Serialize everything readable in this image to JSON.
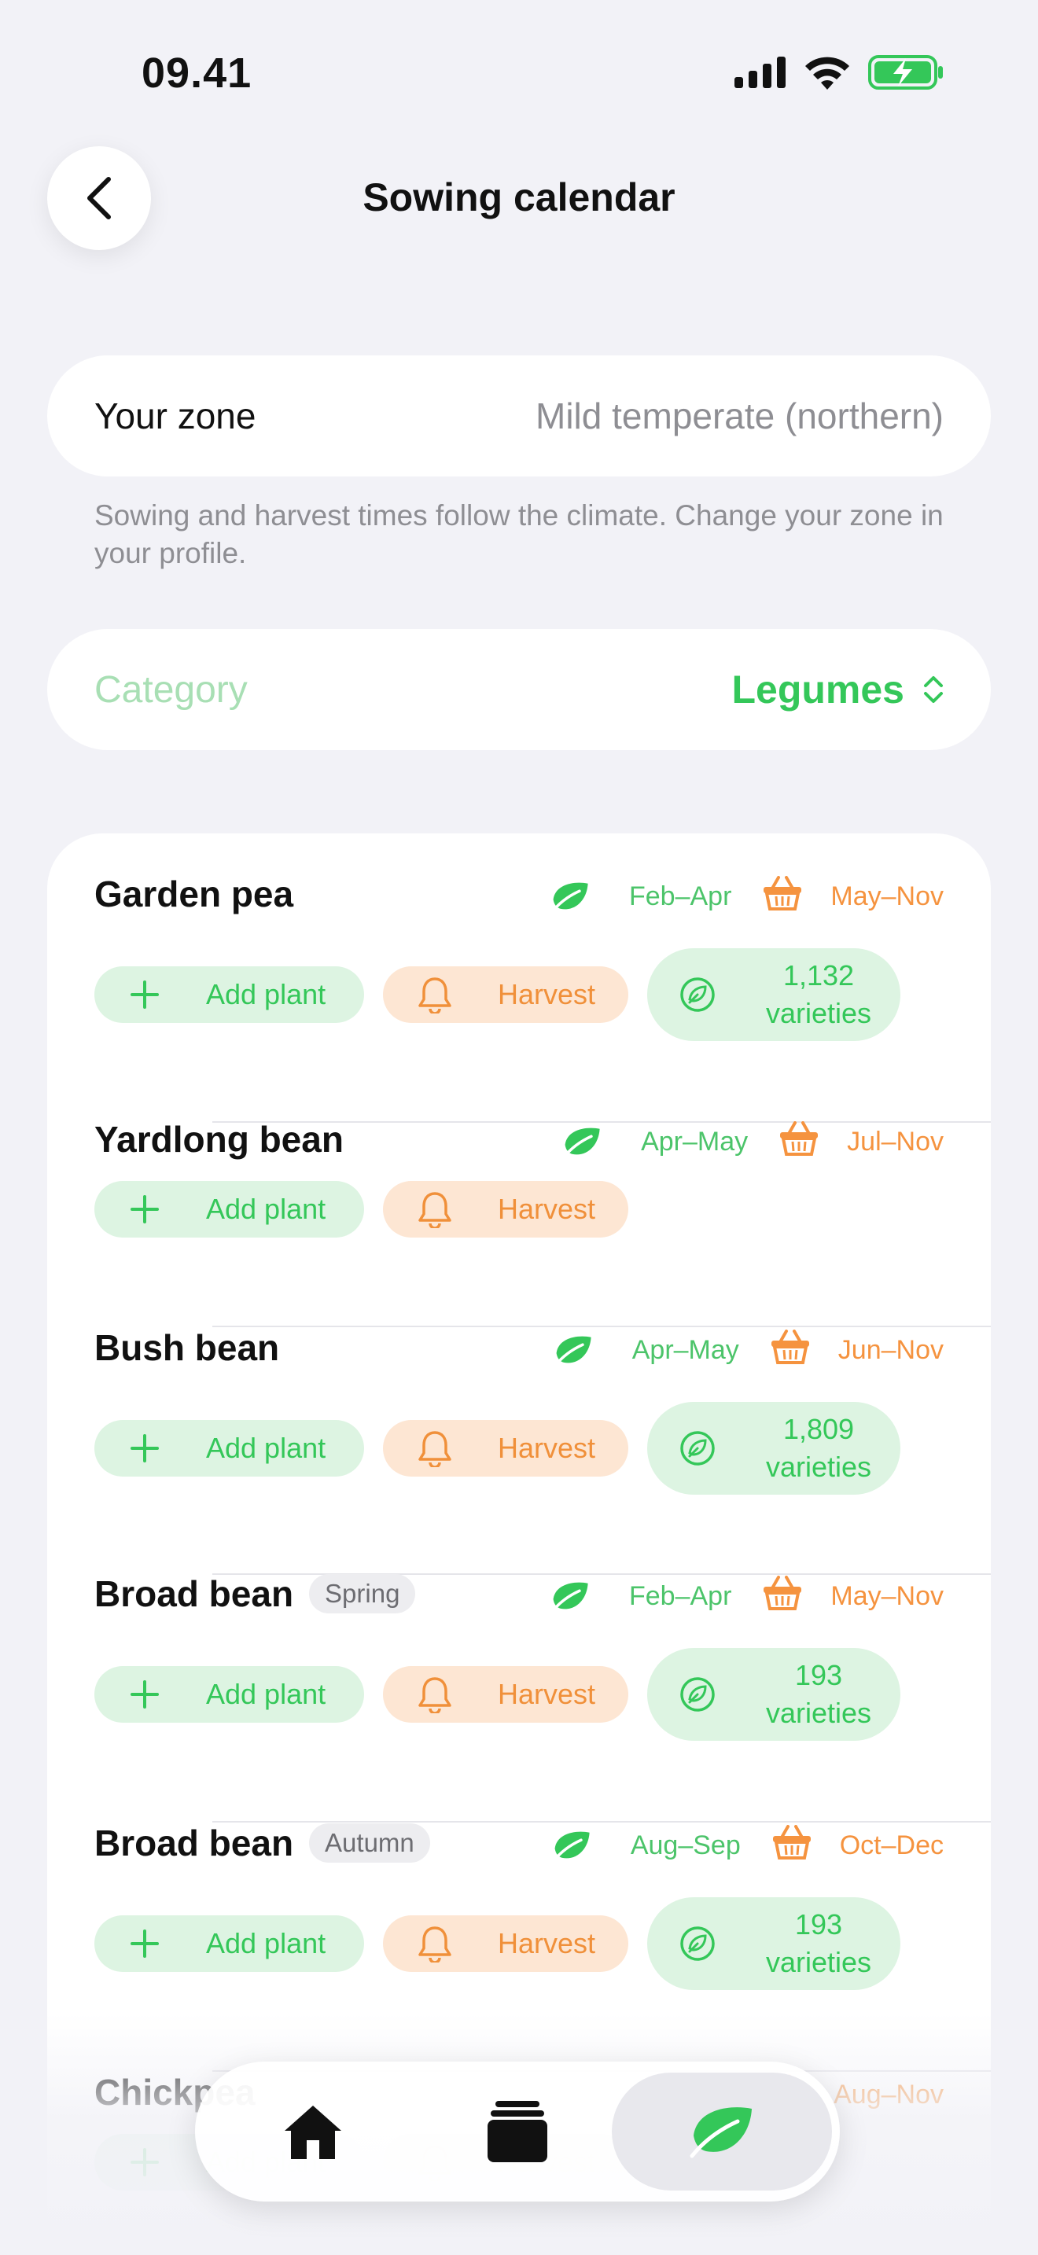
{
  "status_bar": {
    "time": "09.41"
  },
  "nav": {
    "title": "Sowing calendar"
  },
  "zone": {
    "label": "Your zone",
    "value": "Mild temperate (northern)",
    "note": "Sowing and harvest times follow the climate. Change your zone in your profile."
  },
  "category": {
    "label": "Category",
    "value": "Legumes"
  },
  "actions": {
    "add_label": "Add plant",
    "harvest_label": "Harvest",
    "varieties_suffix": "varieties"
  },
  "plants": [
    {
      "name": "Garden pea",
      "tag": "",
      "sow": "Feb–Apr",
      "harvest": "May–Nov",
      "varieties": "1,132"
    },
    {
      "name": "Yardlong bean",
      "tag": "",
      "sow": "Apr–May",
      "harvest": "Jul–Nov",
      "varieties": ""
    },
    {
      "name": "Bush bean",
      "tag": "",
      "sow": "Apr–May",
      "harvest": "Jun–Nov",
      "varieties": "1,809"
    },
    {
      "name": "Broad bean",
      "tag": "Spring",
      "sow": "Feb–Apr",
      "harvest": "May–Nov",
      "varieties": "193"
    },
    {
      "name": "Broad bean",
      "tag": "Autumn",
      "sow": "Aug–Sep",
      "harvest": "Oct–Dec",
      "varieties": "193"
    },
    {
      "name": "Chickpea",
      "tag": "",
      "sow": "",
      "harvest": "Aug–Nov",
      "varieties": ""
    }
  ],
  "colors": {
    "accent_green": "#34c759",
    "harvest_orange": "#f0903a",
    "background": "#f2f2f7"
  },
  "tabs": [
    {
      "name": "home",
      "icon": "house-icon",
      "active": false
    },
    {
      "name": "collection",
      "icon": "stack-icon",
      "active": false
    },
    {
      "name": "calendar",
      "icon": "leaf-icon",
      "active": true
    }
  ]
}
